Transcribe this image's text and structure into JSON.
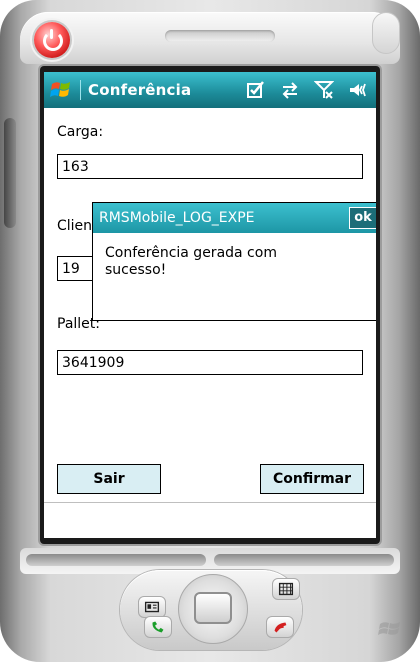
{
  "app": {
    "title": "Conferência",
    "status_icons": [
      "checkbox-icon",
      "sync-arrows-icon",
      "signal-off-icon",
      "speaker-icon"
    ]
  },
  "form": {
    "carga_label": "Carga:",
    "carga_value": "163",
    "cliente_label": "Cliente:",
    "cliente_value": "19",
    "pallet_label": "Pallet:",
    "pallet_value": "3641909"
  },
  "buttons": {
    "sair": "Sair",
    "confirmar": "Confirmar"
  },
  "dialog": {
    "title": "RMSMobile_LOG_EXPE",
    "ok_label": "ok",
    "message_line1": "Conferência gerada com",
    "message_line2": "sucesso!"
  },
  "colors": {
    "titlebar_accent": "#1c8b99",
    "button_fill": "#d9eef3",
    "power_red": "#e02020"
  }
}
